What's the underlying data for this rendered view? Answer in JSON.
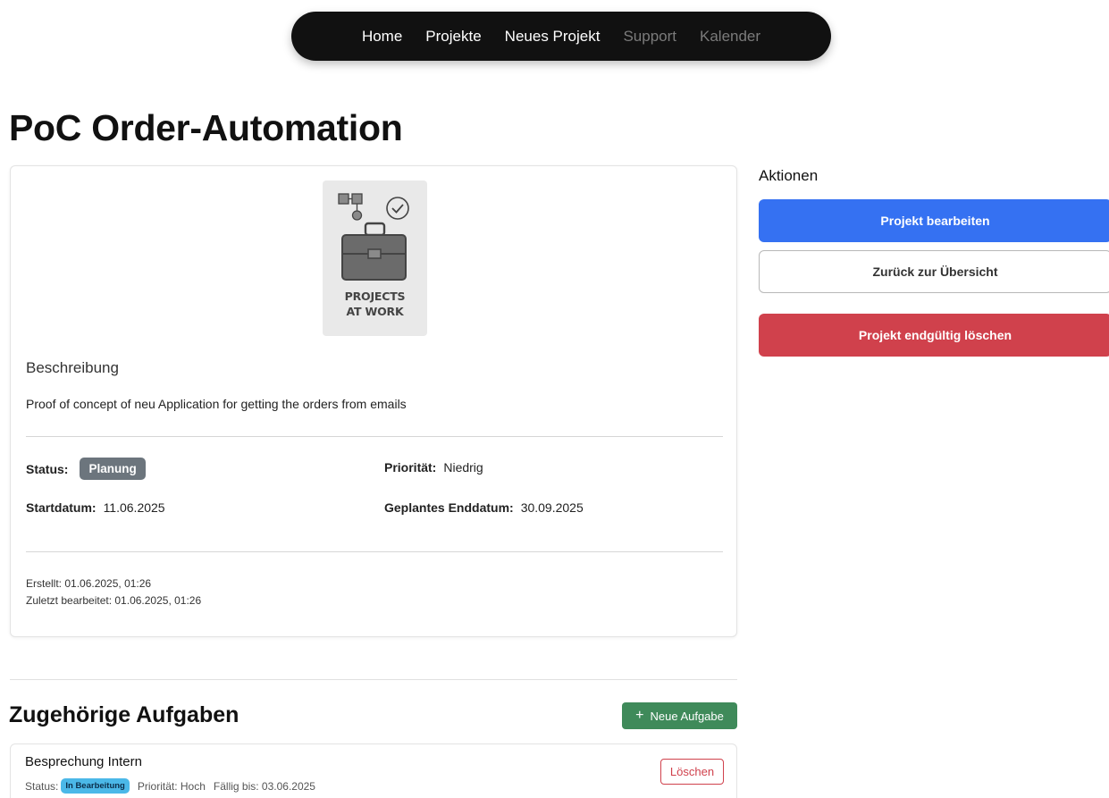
{
  "nav": {
    "items": [
      {
        "label": "Home"
      },
      {
        "label": "Projekte"
      },
      {
        "label": "Neues Projekt"
      },
      {
        "label": "Support"
      },
      {
        "label": "Kalender"
      }
    ]
  },
  "project": {
    "title": "PoC Order-Automation",
    "logo_text_line1": "PROJECTS",
    "logo_text_line2": "AT WORK",
    "description_heading": "Beschreibung",
    "description": "Proof of concept of neu Application for getting the orders from emails",
    "status_label": "Status:",
    "status_value": "Planung",
    "priority_label": "Priorität:",
    "priority_value": "Niedrig",
    "start_label": "Startdatum:",
    "start_value": "11.06.2025",
    "end_label": "Geplantes Enddatum:",
    "end_value": "30.09.2025",
    "created": "Erstellt: 01.06.2025, 01:26",
    "updated": "Zuletzt bearbeitet: 01.06.2025, 01:26"
  },
  "actions": {
    "heading": "Aktionen",
    "edit_label": "Projekt bearbeiten",
    "back_label": "Zurück zur Übersicht",
    "delete_label": "Projekt endgültig löschen"
  },
  "tasks": {
    "heading": "Zugehörige Aufgaben",
    "new_task_label": "Neue Aufgabe",
    "items": [
      {
        "title": "Besprechung Intern",
        "status_label": "Status:",
        "status": "In Bearbeitung",
        "priority": "Priorität: Hoch",
        "due": "Fällig bis: 03.06.2025",
        "delete_label": "Löschen"
      }
    ]
  },
  "colors": {
    "primary": "#3571f2",
    "danger": "#d0414c",
    "success": "#3f8a5a",
    "status_planung": "#6c757d",
    "status_in_bearbeitung": "#4bb8e8"
  }
}
